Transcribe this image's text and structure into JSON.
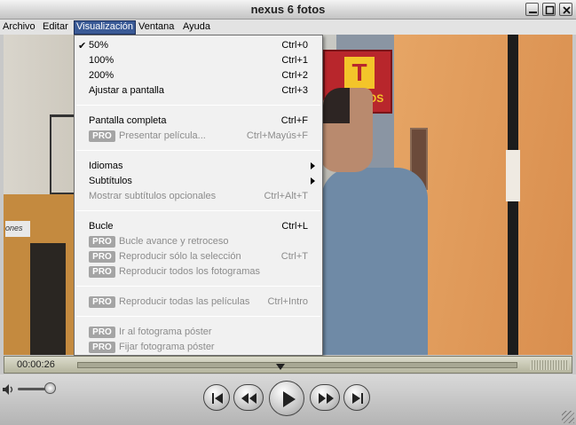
{
  "window": {
    "title": "nexus 6 fotos"
  },
  "menubar": {
    "items": [
      "Archivo",
      "Editar",
      "Visualización",
      "Ventana",
      "Ayuda"
    ]
  },
  "menu": {
    "pro_badge": "PRO",
    "groups": [
      [
        {
          "label": "50%",
          "shortcut": "Ctrl+0",
          "checked": true
        },
        {
          "label": "100%",
          "shortcut": "Ctrl+1"
        },
        {
          "label": "200%",
          "shortcut": "Ctrl+2"
        },
        {
          "label": "Ajustar a pantalla",
          "shortcut": "Ctrl+3"
        }
      ],
      [
        {
          "label": "Pantalla completa",
          "shortcut": "Ctrl+F"
        },
        {
          "label": "Presentar película...",
          "shortcut": "Ctrl+Mayús+F",
          "pro": true,
          "disabled": true
        }
      ],
      [
        {
          "label": "Idiomas",
          "submenu": true
        },
        {
          "label": "Subtítulos",
          "submenu": true
        },
        {
          "label": "Mostrar subtítulos opcionales",
          "shortcut": "Ctrl+Alt+T",
          "disabled": true
        }
      ],
      [
        {
          "label": "Bucle",
          "shortcut": "Ctrl+L"
        },
        {
          "label": "Bucle avance y retroceso",
          "pro": true,
          "disabled": true
        },
        {
          "label": "Reproducir sólo la selección",
          "shortcut": "Ctrl+T",
          "pro": true,
          "disabled": true
        },
        {
          "label": "Reproducir todos los fotogramas",
          "pro": true,
          "disabled": true
        }
      ],
      [
        {
          "label": "Reproducir todas las películas",
          "shortcut": "Ctrl+Intro",
          "pro": true,
          "disabled": true
        }
      ],
      [
        {
          "label": "Ir al fotograma póster",
          "pro": true,
          "disabled": true
        },
        {
          "label": "Fijar fotograma póster",
          "pro": true,
          "disabled": true
        }
      ]
    ]
  },
  "video": {
    "shop_sign": "TABACOS",
    "shop_sign_letter": "T",
    "street_sign": "ones"
  },
  "timeline": {
    "current_time": "00:00:26",
    "position": 0.46
  },
  "volume": {
    "level": 0.85
  }
}
